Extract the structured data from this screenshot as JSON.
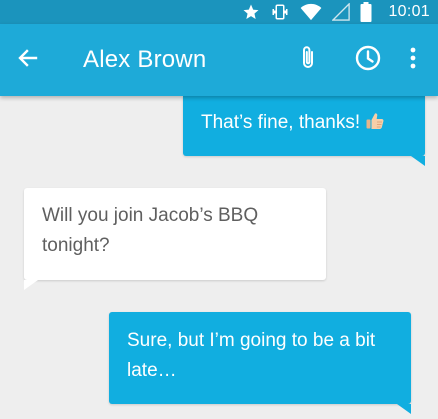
{
  "status_bar": {
    "time": "10:01",
    "icons": [
      "star-icon",
      "vibrate-icon",
      "wifi-icon",
      "signal-icon",
      "battery-icon"
    ]
  },
  "toolbar": {
    "title": "Alex Brown",
    "icons": [
      "back-arrow-icon",
      "paperclip-icon",
      "clock-icon",
      "more-vert-icon"
    ]
  },
  "messages": [
    {
      "direction": "outgoing",
      "text": "That’s fine, thanks!",
      "emoji": "thumbs-up-icon"
    },
    {
      "direction": "incoming",
      "text": "Will you join Jacob’s BBQ tonight?"
    },
    {
      "direction": "outgoing",
      "text": "Sure, but I’m going to be a bit late…"
    }
  ],
  "colors": {
    "status_bar": "#1b94bd",
    "toolbar": "#1eaad8",
    "outgoing_bubble": "#11aee0",
    "incoming_bubble": "#ffffff",
    "background": "#eeeeee"
  }
}
